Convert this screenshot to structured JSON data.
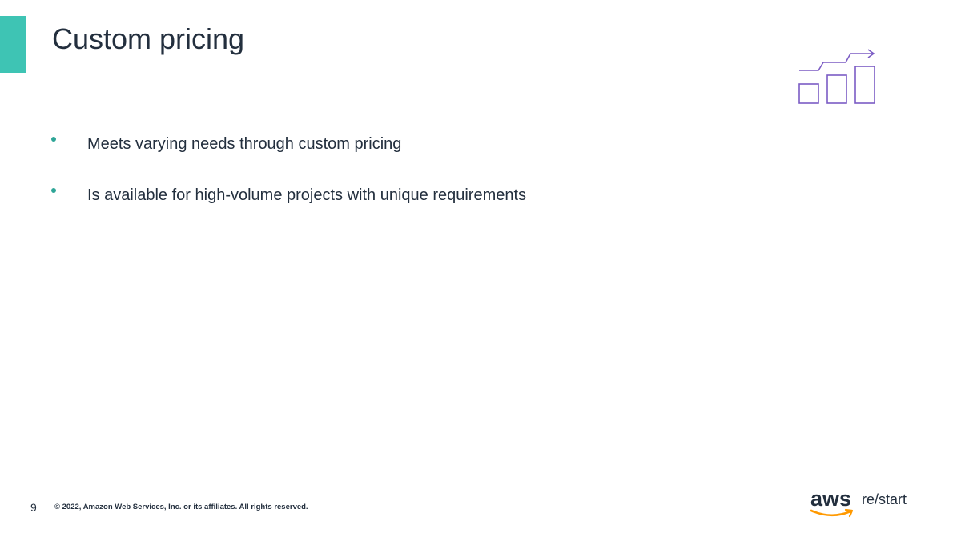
{
  "slide": {
    "title": "Custom pricing",
    "bullets": [
      {
        "text": "Meets varying needs through custom pricing"
      },
      {
        "text": "Is available for high-volume projects with unique requirements"
      }
    ],
    "icon": "growth-bar-chart-icon"
  },
  "footer": {
    "page_number": "9",
    "copyright": "© 2022, Amazon Web Services, Inc. or its affiliates. All rights reserved.",
    "logo_primary": "aws",
    "logo_secondary": "re/start"
  },
  "colors": {
    "accent_teal": "#3ec4b4",
    "bullet_teal": "#2ea597",
    "icon_purple": "#7b5cc4",
    "logo_orange": "#ff9900",
    "text_dark": "#232f3e"
  }
}
